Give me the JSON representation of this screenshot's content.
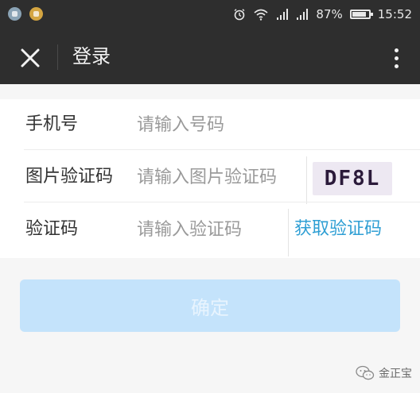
{
  "status_bar": {
    "battery_percent": "87%",
    "time": "15:52",
    "battery_level": 0.87,
    "icons": [
      "alarm-icon",
      "wifi-icon",
      "signal-icon",
      "signal-icon",
      "battery-icon"
    ]
  },
  "title_bar": {
    "title": "登录",
    "close_icon": "close-icon",
    "more_icon": "more-vertical-icon"
  },
  "form": {
    "phone": {
      "label": "手机号",
      "placeholder": "请输入号码"
    },
    "image_code": {
      "label": "图片验证码",
      "placeholder": "请输入图片验证码",
      "captcha_text": "DF8L"
    },
    "sms_code": {
      "label": "验证码",
      "placeholder": "请输入验证码",
      "get_code_label": "获取验证码"
    }
  },
  "confirm_button": {
    "label": "确定"
  },
  "watermark": {
    "text": "金正宝"
  },
  "colors": {
    "bar_bg": "#2e2e2e",
    "accent": "#2f9fd4",
    "confirm_disabled_bg": "#c4e3fb"
  }
}
